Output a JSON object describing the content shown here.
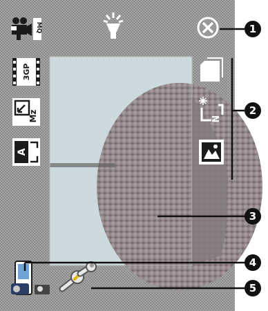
{
  "toolbar": {
    "left_icons": [
      "video-mq-icon",
      "3gp-format-icon",
      "zoom-icon",
      "self-timer-icon"
    ],
    "top_icons": [
      "flash-icon",
      "close-icon"
    ],
    "right_icons": [
      "storage-card-icon",
      "brightness-normal-icon",
      "scene-mode-icon"
    ],
    "bottom_icons": [
      "camera-mode-icon",
      "settings-wrench-icon"
    ]
  },
  "icon_text": {
    "video_quality": "MQ",
    "video_format": "3GP",
    "zoom": "Mz",
    "self_timer": "A",
    "brightness": "N"
  },
  "callouts": [
    {
      "number": "1"
    },
    {
      "number": "2"
    },
    {
      "number": "3"
    },
    {
      "number": "4"
    },
    {
      "number": "5"
    }
  ],
  "colors": {
    "screen_bg": "#8c8c8c",
    "icon_white": "#ffffff",
    "icon_dark": "#1b1b1b",
    "callout_bg": "#111111"
  }
}
